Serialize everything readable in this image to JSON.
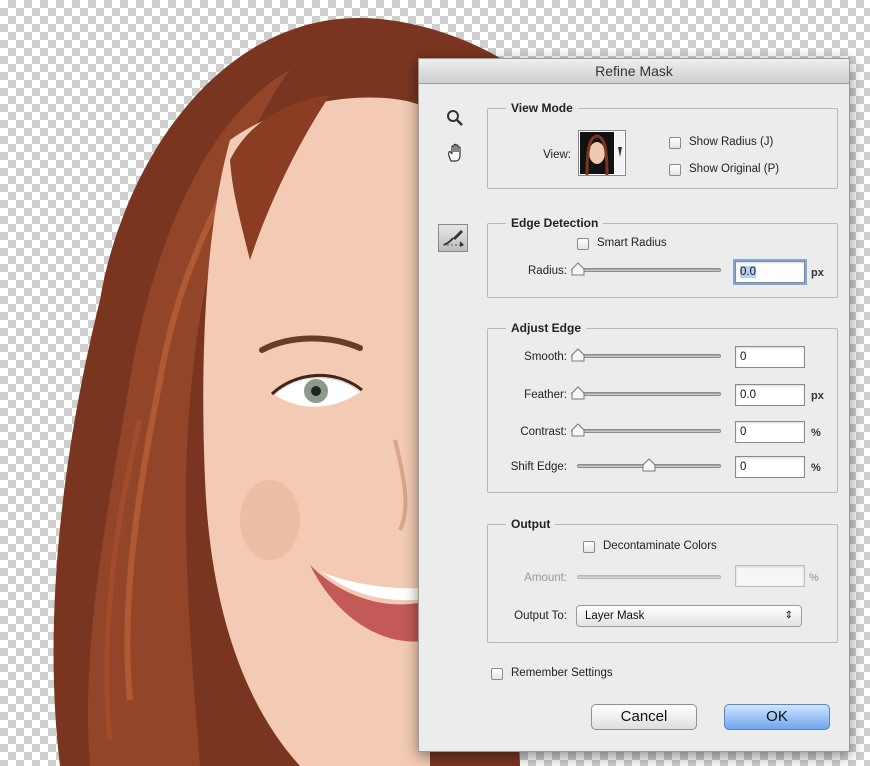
{
  "dialog_title": "Refine Mask",
  "view_mode": {
    "legend": "View Mode",
    "view_label": "View:",
    "show_radius": "Show Radius (J)",
    "show_original": "Show Original (P)"
  },
  "edge_detection": {
    "legend": "Edge Detection",
    "smart_radius": "Smart Radius",
    "radius_label": "Radius:",
    "radius_value": "0.0",
    "radius_unit": "px"
  },
  "adjust_edge": {
    "legend": "Adjust Edge",
    "smooth_label": "Smooth:",
    "smooth_value": "0",
    "feather_label": "Feather:",
    "feather_value": "0.0",
    "feather_unit": "px",
    "contrast_label": "Contrast:",
    "contrast_value": "0",
    "contrast_unit": "%",
    "shift_label": "Shift Edge:",
    "shift_value": "0",
    "shift_unit": "%"
  },
  "output": {
    "legend": "Output",
    "decontaminate": "Decontaminate Colors",
    "amount_label": "Amount:",
    "amount_unit": "%",
    "output_to_label": "Output To:",
    "output_to_value": "Layer Mask"
  },
  "remember_settings": "Remember Settings",
  "buttons": {
    "cancel": "Cancel",
    "ok": "OK"
  },
  "colors": {
    "accent": "#6fa6ec",
    "hair": "#7a3520",
    "skin": "#f3cbb4"
  },
  "icons": [
    "zoom-icon",
    "hand-icon",
    "refine-radius-brush-icon",
    "chevron-updown-icon"
  ]
}
